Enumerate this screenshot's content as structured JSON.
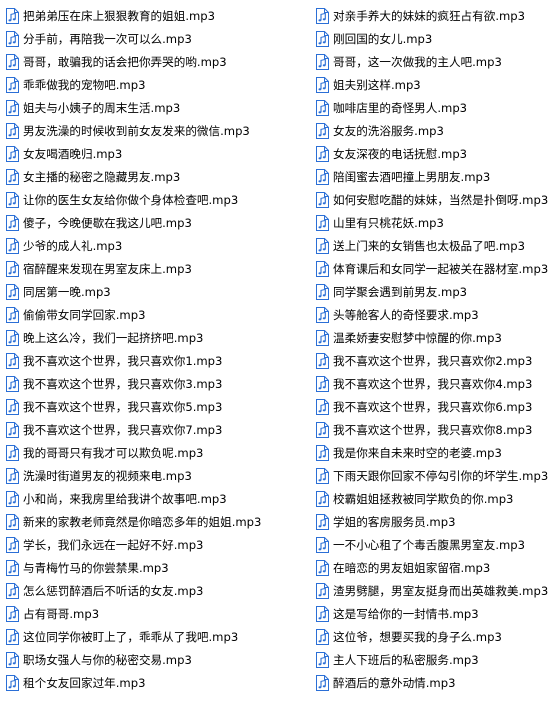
{
  "colors": {
    "icon_blue": "#2b6fd6",
    "icon_border": "#2b6fd6",
    "text": "#000000",
    "background": "#ffffff"
  },
  "icon": "audio-file-icon",
  "files_left": [
    "把弟弟压在床上狠狠教育的姐姐.mp3",
    "分手前，再陪我一次可以么.mp3",
    "哥哥，敢骗我的话会把你弄哭的哟.mp3",
    "乖乖做我的宠物吧.mp3",
    "姐夫与小姨子的周末生活.mp3",
    "男友洗澡的时候收到前女友发来的微信.mp3",
    "女友喝酒晚归.mp3",
    "女主播的秘密之隐藏男友.mp3",
    "让你的医生女友给你做个身体检查吧.mp3",
    "傻子，今晚便歇在我这儿吧.mp3",
    "少爷的成人礼.mp3",
    "宿醉醒来发现在男室友床上.mp3",
    "同居第一晚.mp3",
    "偷偷带女同学回家.mp3",
    "晚上这么冷，我们一起挤挤吧.mp3",
    "我不喜欢这个世界，我只喜欢你1.mp3",
    "我不喜欢这个世界，我只喜欢你3.mp3",
    "我不喜欢这个世界，我只喜欢你5.mp3",
    "我不喜欢这个世界，我只喜欢你7.mp3",
    "我的哥哥只有我才可以欺负呢.mp3",
    "洗澡时街道男友的视频来电.mp3",
    "小和尚，来我房里给我讲个故事吧.mp3",
    "新来的家教老师竟然是你暗恋多年的姐姐.mp3",
    "学长，我们永远在一起好不好.mp3",
    "与青梅竹马的你尝禁果.mp3",
    "怎么惩罚醉酒后不听话的女友.mp3",
    "占有哥哥.mp3",
    "这位同学你被盯上了，乖乖从了我吧.mp3",
    "职场女强人与你的秘密交易.mp3",
    "租个女友回家过年.mp3"
  ],
  "files_right": [
    "对亲手养大的妹妹的疯狂占有欲.mp3",
    "刚回国的女儿.mp3",
    "哥哥，这一次做我的主人吧.mp3",
    "姐夫别这样.mp3",
    "咖啡店里的奇怪男人.mp3",
    "女友的洗浴服务.mp3",
    "女友深夜的电话抚慰.mp3",
    "陪闺蜜去酒吧撞上男朋友.mp3",
    "如何安慰吃醋的妹妹，当然是扑倒呀.mp3",
    "山里有只桃花妖.mp3",
    "送上门来的女销售也太极品了吧.mp3",
    "体育课后和女同学一起被关在器材室.mp3",
    "同学聚会遇到前男友.mp3",
    "头等舱客人的奇怪要求.mp3",
    "温柔娇妻安慰梦中惊醒的你.mp3",
    "我不喜欢这个世界，我只喜欢你2.mp3",
    "我不喜欢这个世界，我只喜欢你4.mp3",
    "我不喜欢这个世界，我只喜欢你6.mp3",
    "我不喜欢这个世界，我只喜欢你8.mp3",
    "我是你来自未来时空的老婆.mp3",
    "下雨天跟你回家不停勾引你的坏学生.mp3",
    "校霸姐姐拯救被同学欺负的你.mp3",
    "学姐的客房服务员.mp3",
    "一不小心租了个毒舌腹黑男室友.mp3",
    "在暗恋的男友姐姐家留宿.mp3",
    "渣男劈腿，男室友挺身而出英雄救美.mp3",
    "这是写给你的一封情书.mp3",
    "这位爷，想要买我的身子么.mp3",
    "主人下班后的私密服务.mp3",
    "醉酒后的意外动情.mp3"
  ]
}
